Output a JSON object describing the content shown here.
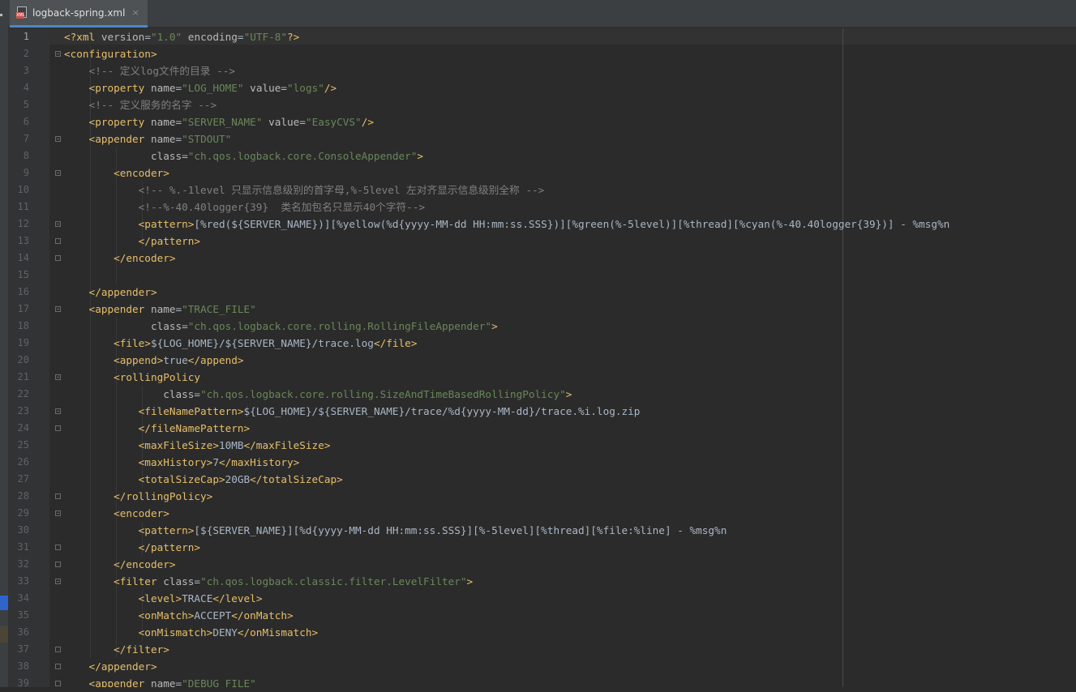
{
  "tab": {
    "filename": "logback-spring.xml",
    "close": "×",
    "icon": "xml-file-icon"
  },
  "colors": {
    "tag": "#e8bf6a",
    "attr_name": "#bababa",
    "attr_value": "#6a8759",
    "comment": "#808080",
    "text": "#a9b7c6"
  },
  "gutter": {
    "numbers": [
      "1",
      "2",
      "3",
      "4",
      "5",
      "6",
      "7",
      "8",
      "9",
      "10",
      "11",
      "12",
      "13",
      "14",
      "15",
      "16",
      "17",
      "18",
      "19",
      "20",
      "21",
      "22",
      "23",
      "24",
      "25",
      "26",
      "27",
      "28",
      "29",
      "30",
      "31",
      "32",
      "33",
      "34",
      "35",
      "36",
      "37",
      "38",
      "39"
    ]
  },
  "code": [
    [
      [
        "tg",
        "<?xml "
      ],
      [
        "an",
        "version"
      ],
      [
        "tx",
        "="
      ],
      [
        "av",
        "\"1.0\""
      ],
      [
        "an",
        " encoding"
      ],
      [
        "tx",
        "="
      ],
      [
        "av",
        "\"UTF-8\""
      ],
      [
        "tg",
        "?>"
      ]
    ],
    [
      [
        "tg",
        "<configuration>"
      ]
    ],
    [
      [
        "cm",
        "    <!-- 定义log文件的目录 -->"
      ]
    ],
    [
      [
        "tg",
        "    <property "
      ],
      [
        "an",
        "name"
      ],
      [
        "tx",
        "="
      ],
      [
        "av",
        "\"LOG_HOME\""
      ],
      [
        "an",
        " value"
      ],
      [
        "tx",
        "="
      ],
      [
        "av",
        "\"logs\""
      ],
      [
        "tg",
        "/>"
      ]
    ],
    [
      [
        "cm",
        "    <!-- 定义服务的名字 -->"
      ]
    ],
    [
      [
        "tg",
        "    <property "
      ],
      [
        "an",
        "name"
      ],
      [
        "tx",
        "="
      ],
      [
        "av",
        "\"SERVER_NAME\""
      ],
      [
        "an",
        " value"
      ],
      [
        "tx",
        "="
      ],
      [
        "av",
        "\"EasyCVS\""
      ],
      [
        "tg",
        "/>"
      ]
    ],
    [
      [
        "tg",
        "    <appender "
      ],
      [
        "an",
        "name"
      ],
      [
        "tx",
        "="
      ],
      [
        "av",
        "\"STDOUT\""
      ]
    ],
    [
      [
        "an",
        "              class"
      ],
      [
        "tx",
        "="
      ],
      [
        "av",
        "\"ch.qos.logback.core.ConsoleAppender\""
      ],
      [
        "tg",
        ">"
      ]
    ],
    [
      [
        "tg",
        "        <encoder>"
      ]
    ],
    [
      [
        "cm",
        "            <!-- %.-1level 只显示信息级别的首字母,%-5level 左对齐显示信息级别全称 -->"
      ]
    ],
    [
      [
        "cm",
        "            <!--%-40.40logger{39}  类名加包名只显示40个字符-->"
      ]
    ],
    [
      [
        "tg",
        "            <pattern>"
      ],
      [
        "tx",
        "[%red(${SERVER_NAME})][%yellow(%d{yyyy-MM-dd HH:mm:ss.SSS})][%green(%-5level)][%thread][%cyan(%-40.40logger{39})] - %msg%n"
      ]
    ],
    [
      [
        "tg",
        "            </pattern>"
      ]
    ],
    [
      [
        "tg",
        "        </encoder>"
      ]
    ],
    [],
    [
      [
        "tg",
        "    </appender>"
      ]
    ],
    [
      [
        "tg",
        "    <appender "
      ],
      [
        "an",
        "name"
      ],
      [
        "tx",
        "="
      ],
      [
        "av",
        "\"TRACE_FILE\""
      ]
    ],
    [
      [
        "an",
        "              class"
      ],
      [
        "tx",
        "="
      ],
      [
        "av",
        "\"ch.qos.logback.core.rolling.RollingFileAppender\""
      ],
      [
        "tg",
        ">"
      ]
    ],
    [
      [
        "tg",
        "        <file>"
      ],
      [
        "tx",
        "${LOG_HOME}/${SERVER_NAME}/trace.log"
      ],
      [
        "tg",
        "</file>"
      ]
    ],
    [
      [
        "tg",
        "        <append>"
      ],
      [
        "tx",
        "true"
      ],
      [
        "tg",
        "</append>"
      ]
    ],
    [
      [
        "tg",
        "        <rollingPolicy"
      ]
    ],
    [
      [
        "an",
        "                class"
      ],
      [
        "tx",
        "="
      ],
      [
        "av",
        "\"ch.qos.logback.core.rolling.SizeAndTimeBasedRollingPolicy\""
      ],
      [
        "tg",
        ">"
      ]
    ],
    [
      [
        "tg",
        "            <fileNamePattern>"
      ],
      [
        "tx",
        "${LOG_HOME}/${SERVER_NAME}/trace/%d{yyyy-MM-dd}/trace.%i.log.zip"
      ]
    ],
    [
      [
        "tg",
        "            </fileNamePattern>"
      ]
    ],
    [
      [
        "tg",
        "            <maxFileSize>"
      ],
      [
        "tx",
        "10MB"
      ],
      [
        "tg",
        "</maxFileSize>"
      ]
    ],
    [
      [
        "tg",
        "            <maxHistory>"
      ],
      [
        "tx",
        "7"
      ],
      [
        "tg",
        "</maxHistory>"
      ]
    ],
    [
      [
        "tg",
        "            <totalSizeCap>"
      ],
      [
        "tx",
        "20GB"
      ],
      [
        "tg",
        "</totalSizeCap>"
      ]
    ],
    [
      [
        "tg",
        "        </rollingPolicy>"
      ]
    ],
    [
      [
        "tg",
        "        <encoder>"
      ]
    ],
    [
      [
        "tg",
        "            <pattern>"
      ],
      [
        "tx",
        "[${SERVER_NAME}][%d{yyyy-MM-dd HH:mm:ss.SSS}][%-5level][%thread][%file:%line] - %msg%n"
      ]
    ],
    [
      [
        "tg",
        "            </pattern>"
      ]
    ],
    [
      [
        "tg",
        "        </encoder>"
      ]
    ],
    [
      [
        "tg",
        "        <filter "
      ],
      [
        "an",
        "class"
      ],
      [
        "tx",
        "="
      ],
      [
        "av",
        "\"ch.qos.logback.classic.filter.LevelFilter\""
      ],
      [
        "tg",
        ">"
      ]
    ],
    [
      [
        "tg",
        "            <level>"
      ],
      [
        "tx",
        "TRACE"
      ],
      [
        "tg",
        "</level>"
      ]
    ],
    [
      [
        "tg",
        "            <onMatch>"
      ],
      [
        "tx",
        "ACCEPT"
      ],
      [
        "tg",
        "</onMatch>"
      ]
    ],
    [
      [
        "tg",
        "            <onMismatch>"
      ],
      [
        "tx",
        "DENY"
      ],
      [
        "tg",
        "</onMismatch>"
      ]
    ],
    [
      [
        "tg",
        "        </filter>"
      ]
    ],
    [
      [
        "tg",
        "    </appender>"
      ]
    ],
    [
      [
        "tg",
        "    <appender "
      ],
      [
        "an",
        "name"
      ],
      [
        "tx",
        "="
      ],
      [
        "av",
        "\"DEBUG_FILE\""
      ]
    ]
  ]
}
